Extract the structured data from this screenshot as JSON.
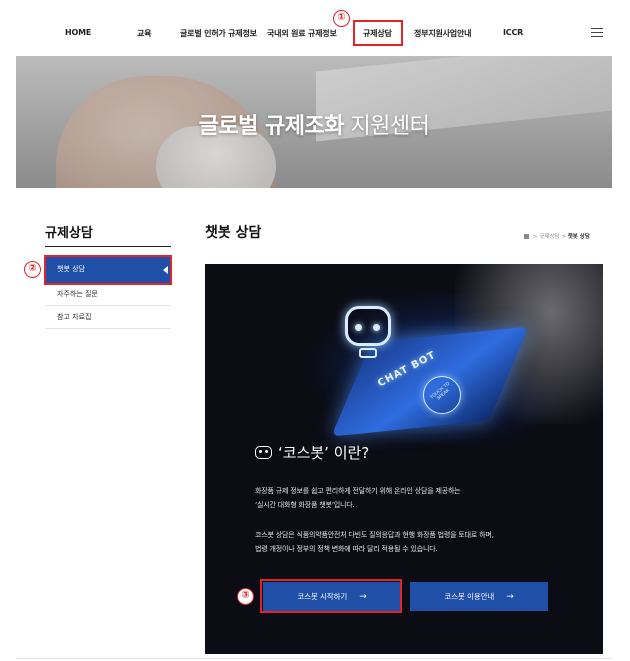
{
  "nav": {
    "items": [
      "HOME",
      "교육",
      "글로벌 인허가 규제정보",
      "국내외 원료 규제정보",
      "규제상담",
      "정부지원사업안내",
      "ICCR"
    ]
  },
  "hero": {
    "title_bold": "글로벌 규제조화",
    "title_light": "지원센터"
  },
  "sidebar": {
    "title": "규제상담",
    "items": [
      "챗봇 상담",
      "자주하는 질문",
      "참고 자료집"
    ]
  },
  "main": {
    "title": "챗봇 상담",
    "breadcrumb": [
      "규제상담",
      "챗봇 상담"
    ],
    "banner": {
      "chatbot_label": "CHAT BOT",
      "touch_label": "TOUCH TO SPEAK"
    },
    "what_title": "‘코스봇’ 이란?",
    "para1": [
      "화장품 규제 정보를 쉽고 편리하게 전달하기 위해 온라인 상담을 제공하는",
      "‘실시간 대화형 화장품 챗봇’입니다."
    ],
    "para2": [
      "코스봇 상담은 식품의약품안전처 다빈도 질의응답과 현행 화장품 법령을 토대로 하며,",
      "법령 개정이나 정부의 정책 변화에 따라 달리 적용될 수 있습니다."
    ],
    "buttons": {
      "start": "코스봇 시작하기",
      "guide": "코스봇 이용안내",
      "arrow": "→"
    }
  },
  "annotations": [
    "①",
    "②",
    "③"
  ],
  "colors": {
    "accent_blue": "#1f4fa6",
    "annotation_red": "#e0242a",
    "panel_dark": "#0b0c14"
  }
}
